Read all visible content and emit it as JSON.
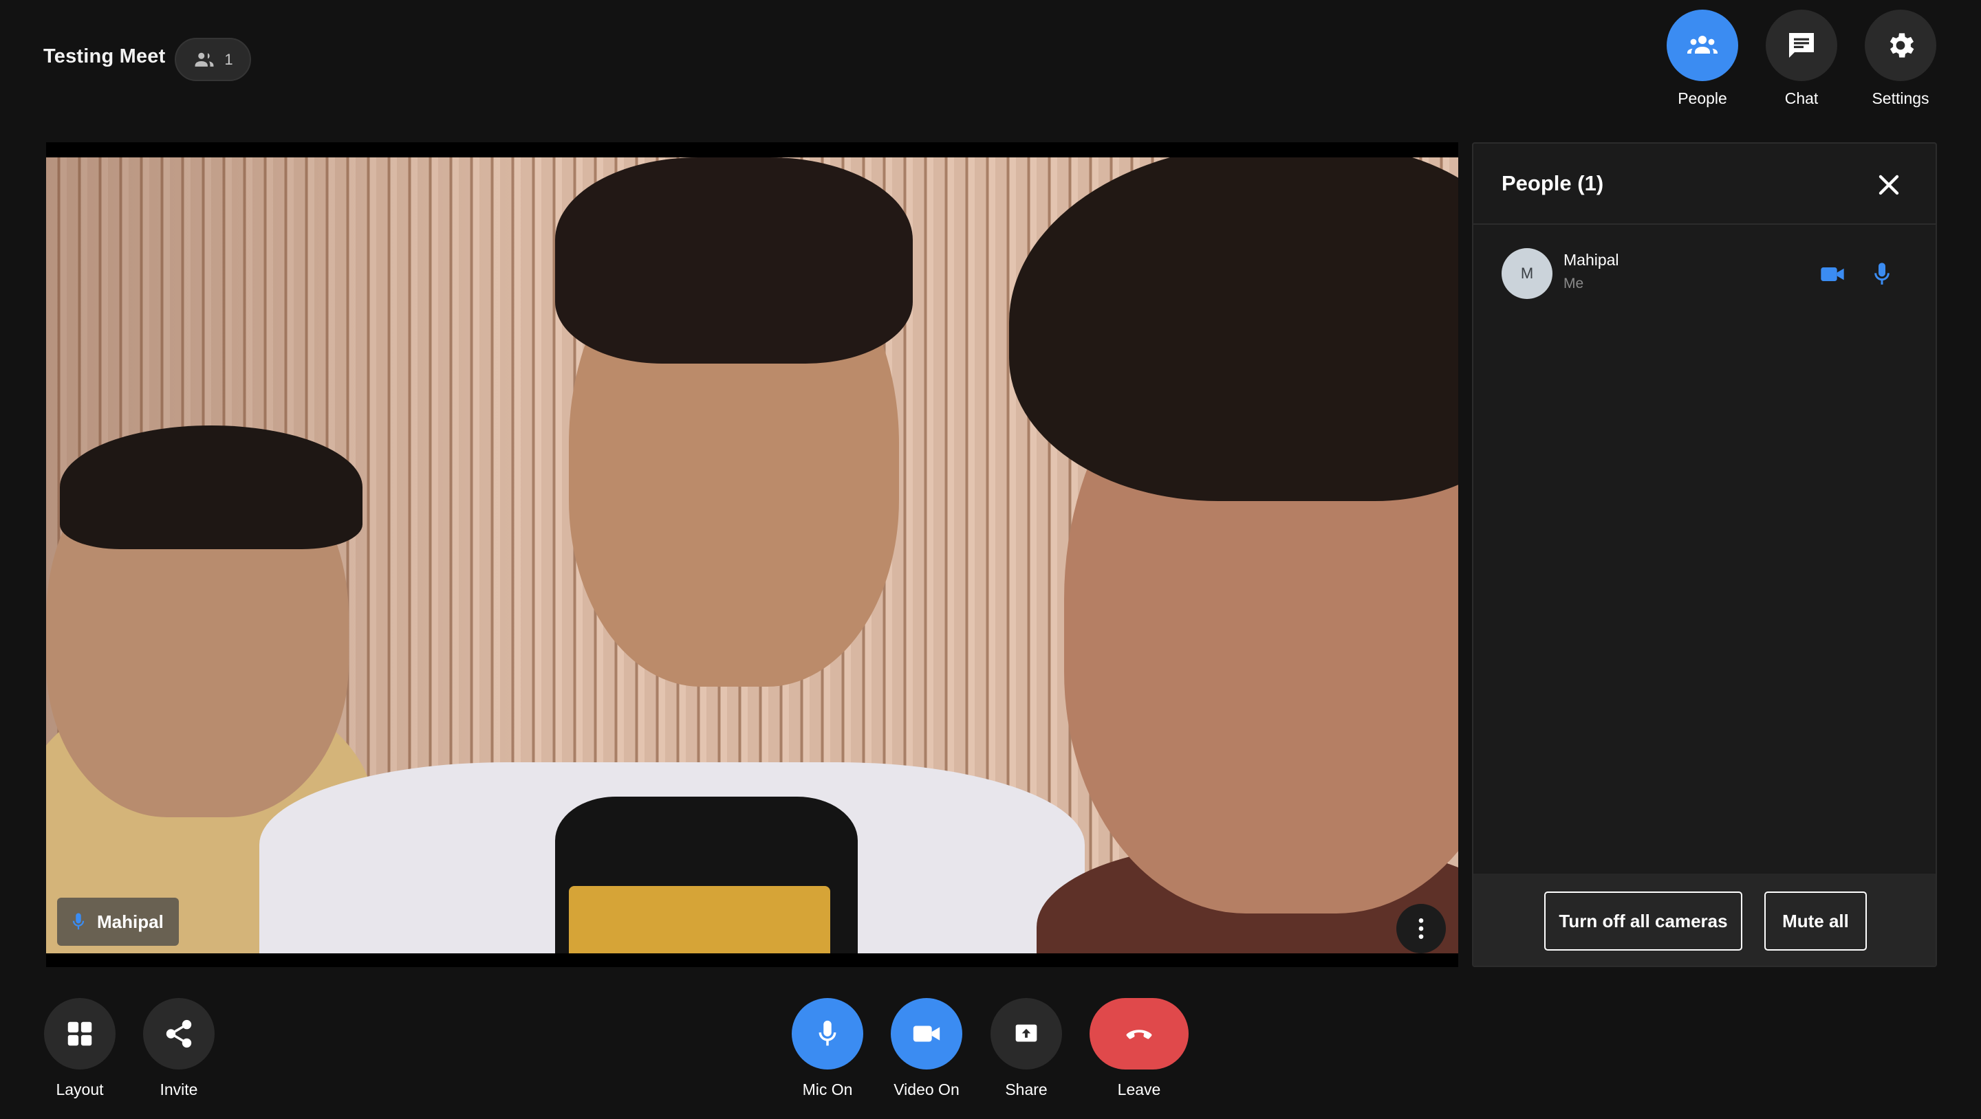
{
  "header": {
    "meeting_title": "Testing Meet",
    "participant_count": "1"
  },
  "top_actions": {
    "people_label": "People",
    "chat_label": "Chat",
    "settings_label": "Settings"
  },
  "video": {
    "participant_name": "Mahipal"
  },
  "people_panel": {
    "title": "People (1)",
    "participants": [
      {
        "initial": "M",
        "name": "Mahipal",
        "subtitle": "Me"
      }
    ],
    "turn_off_cameras_label": "Turn off all cameras",
    "mute_all_label": "Mute all"
  },
  "bottom_toolbar": {
    "layout_label": "Layout",
    "invite_label": "Invite",
    "mic_label": "Mic On",
    "video_label": "Video On",
    "share_label": "Share",
    "leave_label": "Leave"
  },
  "colors": {
    "background": "#121212",
    "accent_blue": "#3b8cf2",
    "leave_red": "#e0494b",
    "panel": "#1b1b1b"
  },
  "icons": {
    "participants_pill": "people-icon",
    "people": "group-icon",
    "chat": "chat-bubble-icon",
    "settings": "gear-icon",
    "close": "close-icon",
    "camera": "video-camera-icon",
    "mic": "microphone-icon",
    "menu": "more-vertical-icon",
    "layout": "grid-icon",
    "invite": "share-nodes-icon",
    "share": "screen-share-icon",
    "leave": "phone-hangup-icon"
  }
}
